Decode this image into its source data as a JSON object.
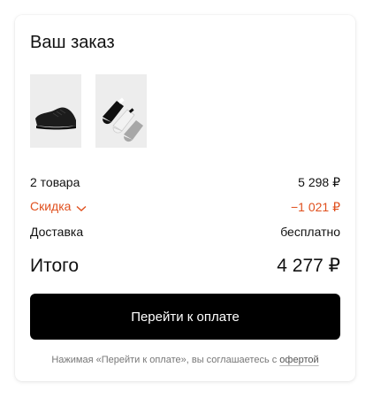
{
  "order": {
    "title": "Ваш заказ",
    "items": [
      {
        "icon": "black-sneaker-image"
      },
      {
        "icon": "socks-set-image"
      }
    ],
    "rows": {
      "items_label": "2 товара",
      "items_value": "5 298 ₽",
      "discount_label": "Скидка",
      "discount_value": "−1 021 ₽",
      "delivery_label": "Доставка",
      "delivery_value": "бесплатно"
    },
    "total_label": "Итого",
    "total_value": "4 277 ₽",
    "pay_button": "Перейти к оплате",
    "note_text": "Нажимая «Перейти к оплате», вы соглашаетесь с",
    "note_link": "офертой"
  },
  "colors": {
    "accent": "#e0501e",
    "button": "#000000"
  }
}
